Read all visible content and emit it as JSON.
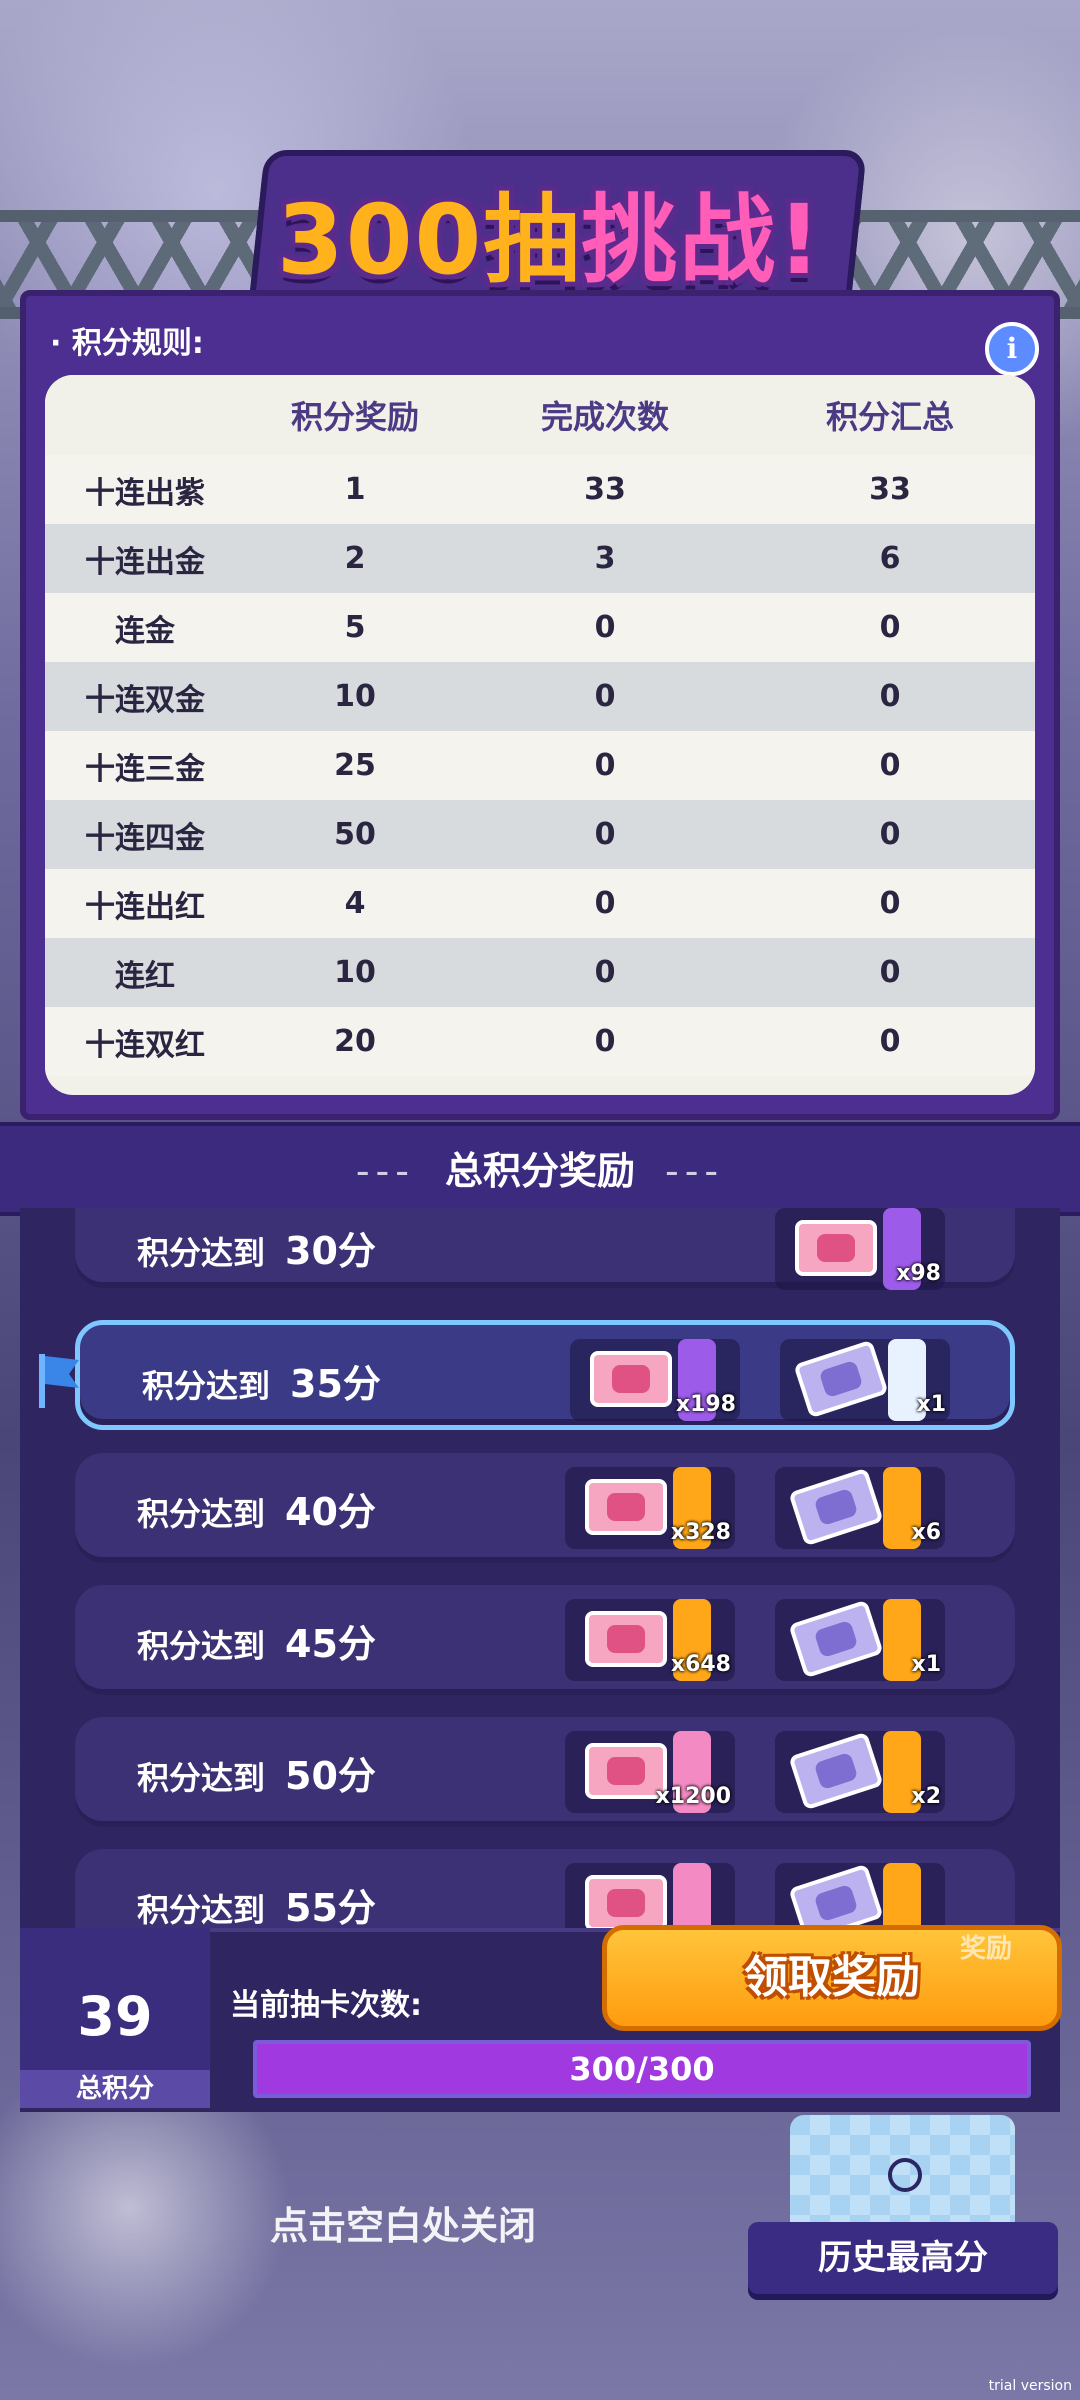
{
  "title": {
    "main": "300抽",
    "accent": "挑战!"
  },
  "rules": {
    "label": "积分规则:",
    "headers": [
      "",
      "积分奖励",
      "完成次数",
      "积分汇总"
    ],
    "rows": [
      {
        "name": "十连出紫",
        "points": "1",
        "count": "33",
        "total": "33"
      },
      {
        "name": "十连出金",
        "points": "2",
        "count": "3",
        "total": "6"
      },
      {
        "name": "连金",
        "points": "5",
        "count": "0",
        "total": "0"
      },
      {
        "name": "十连双金",
        "points": "10",
        "count": "0",
        "total": "0"
      },
      {
        "name": "十连三金",
        "points": "25",
        "count": "0",
        "total": "0"
      },
      {
        "name": "十连四金",
        "points": "50",
        "count": "0",
        "total": "0"
      },
      {
        "name": "十连出红",
        "points": "4",
        "count": "0",
        "total": "0"
      },
      {
        "name": "连红",
        "points": "10",
        "count": "0",
        "total": "0"
      },
      {
        "name": "十连双红",
        "points": "20",
        "count": "0",
        "total": "0"
      }
    ]
  },
  "section": {
    "title": "总积分奖励",
    "dash": "---"
  },
  "rewards": [
    {
      "label": "积分达到",
      "score": "30分",
      "item1_qty": "",
      "item2_qty": "x98"
    },
    {
      "label": "积分达到",
      "score": "35分",
      "item1_qty": "x198",
      "item2_qty": "x1"
    },
    {
      "label": "积分达到",
      "score": "40分",
      "item1_qty": "x328",
      "item2_qty": "x6"
    },
    {
      "label": "积分达到",
      "score": "45分",
      "item1_qty": "x648",
      "item2_qty": "x1"
    },
    {
      "label": "积分达到",
      "score": "50分",
      "item1_qty": "x1200",
      "item2_qty": "x2"
    },
    {
      "label": "积分达到",
      "score": "55分",
      "item1_qty": "",
      "item2_qty": ""
    }
  ],
  "bottom": {
    "total_score": "39",
    "total_score_label": "总积分",
    "draw_label": "当前抽卡次数:",
    "progress_text": "300/300",
    "progress_fraction": 1.0,
    "claim_button": "领取奖励",
    "claim_tag": "奖励"
  },
  "footer": {
    "close_hint": "点击空白处关闭",
    "history_button": "历史最高分"
  },
  "watermark": "trial version",
  "icons": {
    "info": "info-icon",
    "flag": "flag-icon",
    "ticket": "ticket-icon"
  }
}
